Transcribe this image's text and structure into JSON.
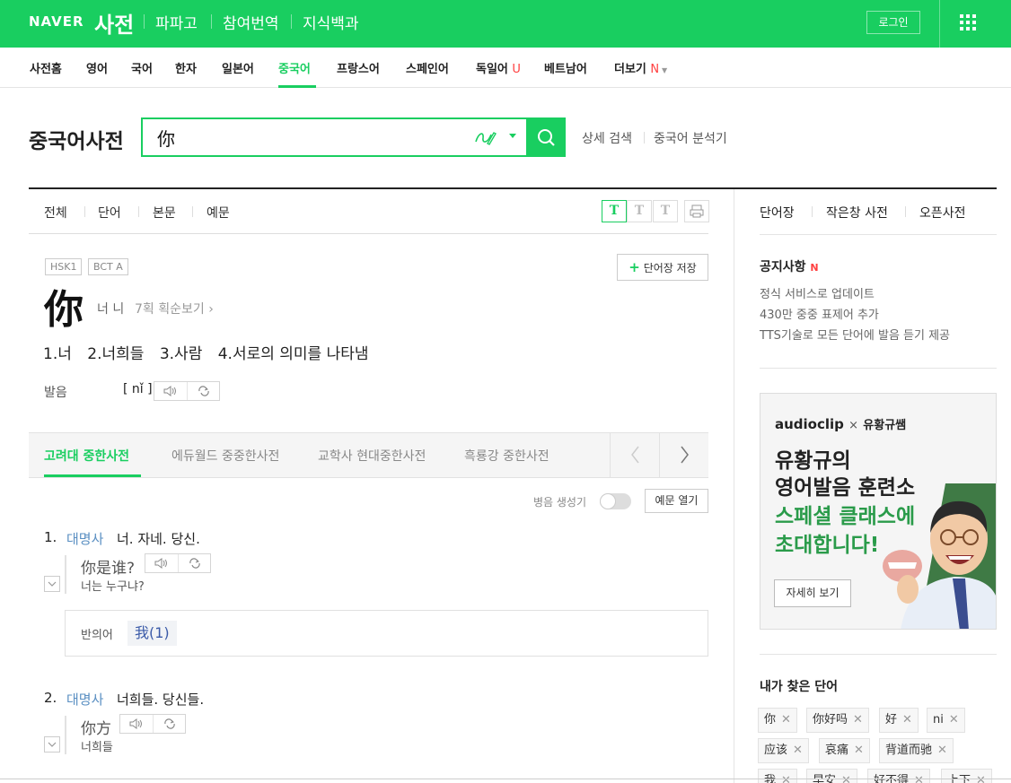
{
  "topbar": {
    "logo": "NAVER",
    "service": "사전",
    "nav": [
      "파파고",
      "참여번역",
      "지식백과"
    ],
    "login": "로그인",
    "menu_icon": "grid-menu-icon"
  },
  "langnav": {
    "items": [
      "사전홈",
      "영어",
      "국어",
      "한자",
      "일본어",
      "중국어",
      "프랑스어",
      "스페인어",
      "독일어",
      "베트남어",
      "더보기"
    ],
    "active": "중국어",
    "badge_u": "U",
    "badge_n": "N"
  },
  "search": {
    "title": "중국어사전",
    "query": "你",
    "handwriting_icon": "handwriting-icon",
    "search_icon": "search-icon",
    "advanced": "상세 검색",
    "analyzer": "중국어 분석기"
  },
  "result_tabs": [
    "전체",
    "단어",
    "본문",
    "예문"
  ],
  "font_sizes": [
    "T",
    "T",
    "T"
  ],
  "entry": {
    "tags": [
      "HSK1",
      "BCT A"
    ],
    "save": "단어장 저장",
    "hanzi": "你",
    "reading": "너 니",
    "strokes": "7획 획순보기",
    "meanings": [
      "1.너",
      "2.너희들",
      "3.사람",
      "4.서로의 의미를 나타냄"
    ],
    "pron_label": "발음",
    "pinyin": "[ nǐ ]"
  },
  "dict_tabs": [
    "고려대 중한사전",
    "에듀월드 중중한사전",
    "교학사 현대중한사전",
    "흑룡강 중한사전"
  ],
  "pinyin_gen": "병음 생성기",
  "examples_open": "예문 열기",
  "senses": [
    {
      "num": "1.",
      "pos": "대명사",
      "def": "너. 자네. 당신.",
      "example_cn": "你是谁?",
      "example_kr": "너는 누구냐?"
    },
    {
      "num": "2.",
      "pos": "대명사",
      "def": "너희들. 당신들.",
      "example_cn": "你方",
      "example_kr": "너희들"
    }
  ],
  "antonym": {
    "label": "반의어",
    "value": "我(1)"
  },
  "sidebar": {
    "tabs": [
      "단어장",
      "작은창 사전",
      "오픈사전"
    ],
    "notice_title": "공지사항",
    "notice_badge": "N",
    "notices": [
      "정식 서비스로 업데이트",
      "430만 중중 표제어 추가",
      "TTS기술로 모든 단어에 발음 듣기 제공"
    ],
    "ad": {
      "brand": "audioclip",
      "brand_x": "×",
      "brand_sub": "유황규쌤",
      "lines": [
        "유황규의",
        "영어발음 훈련소",
        "스페셜 클래스에",
        "초대합니다!"
      ],
      "more": "자세히 보기"
    },
    "recent_title": "내가 찾은 단어",
    "recent": [
      "你",
      "你好吗",
      "好",
      "ni",
      "应该",
      "哀痛",
      "背道而驰",
      "我",
      "早安",
      "好不得",
      "上下"
    ]
  },
  "colors": {
    "brand": "#19ce60",
    "link_blue": "#5a8fc2",
    "badge_red": "#ff3f3f"
  }
}
